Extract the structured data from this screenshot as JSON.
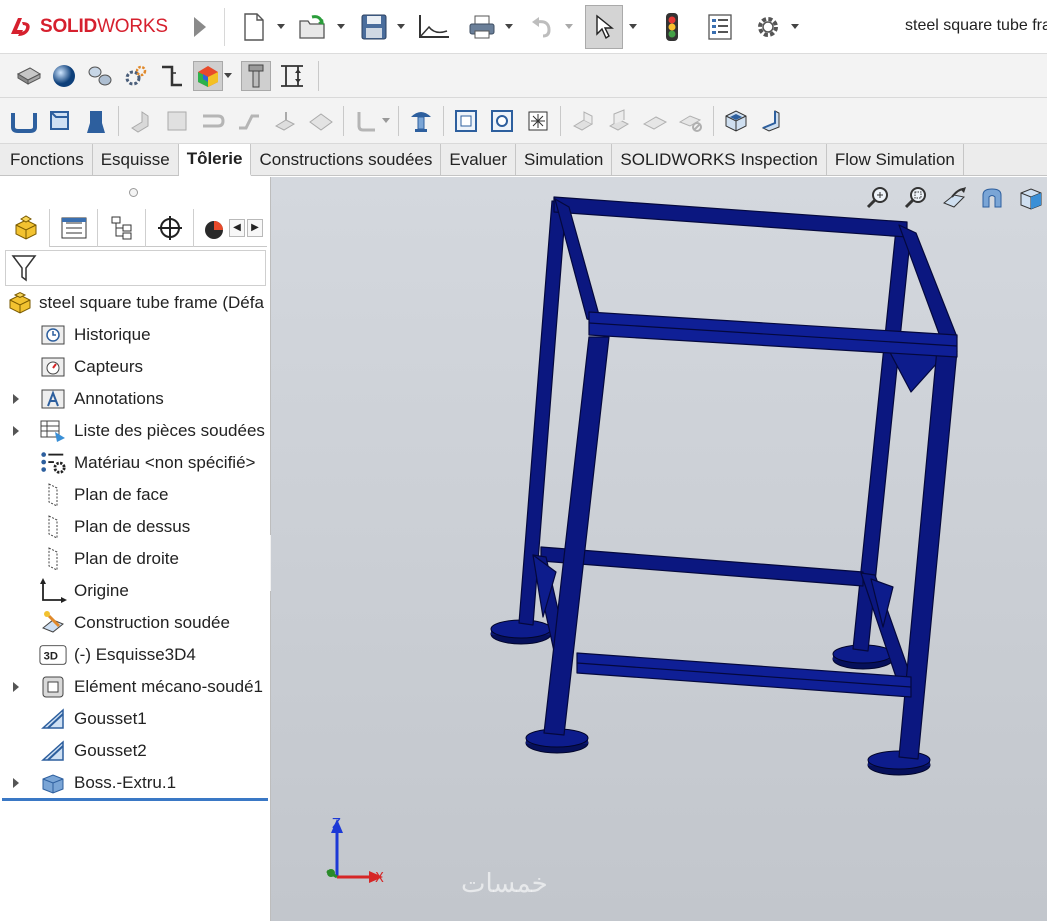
{
  "app": {
    "brand_prefix": "SOLID",
    "brand_suffix": "WORKS",
    "document_title": "steel square tube frame"
  },
  "tabs": [
    {
      "label": "Fonctions",
      "active": false
    },
    {
      "label": "Esquisse",
      "active": false
    },
    {
      "label": "Tôlerie",
      "active": true
    },
    {
      "label": "Constructions soudées",
      "active": false
    },
    {
      "label": "Evaluer",
      "active": false
    },
    {
      "label": "Simulation",
      "active": false
    },
    {
      "label": "SOLIDWORKS Inspection",
      "active": false
    },
    {
      "label": "Flow Simulation",
      "active": false
    }
  ],
  "tree": {
    "root": "steel square tube frame (Défa",
    "items": [
      {
        "label": "Historique",
        "icon": "history-icon",
        "expandable": false
      },
      {
        "label": "Capteurs",
        "icon": "sensor-icon",
        "expandable": false
      },
      {
        "label": "Annotations",
        "icon": "annotations-icon",
        "expandable": true
      },
      {
        "label": "Liste des pièces soudées",
        "icon": "cut-list-icon",
        "expandable": true
      },
      {
        "label": "Matériau <non spécifié>",
        "icon": "material-icon",
        "expandable": false
      },
      {
        "label": "Plan de face",
        "icon": "plane-icon",
        "expandable": false
      },
      {
        "label": "Plan de dessus",
        "icon": "plane-icon",
        "expandable": false
      },
      {
        "label": "Plan de droite",
        "icon": "plane-icon",
        "expandable": false
      },
      {
        "label": "Origine",
        "icon": "origin-icon",
        "expandable": false
      },
      {
        "label": "Construction soudée",
        "icon": "weldment-icon",
        "expandable": false
      },
      {
        "label": "(-) Esquisse3D4",
        "icon": "sketch3d-icon",
        "expandable": false
      },
      {
        "label": "Elément mécano-soudé1",
        "icon": "structural-member-icon",
        "expandable": true
      },
      {
        "label": "Gousset1",
        "icon": "gusset-icon",
        "expandable": false
      },
      {
        "label": "Gousset2",
        "icon": "gusset-icon",
        "expandable": false
      },
      {
        "label": "Boss.-Extru.1",
        "icon": "extrude-icon",
        "expandable": true
      }
    ]
  },
  "triad": {
    "z": "Z",
    "x": "X"
  },
  "watermark": "خمسات",
  "colors": {
    "frame": "#0b1780",
    "frame_edge": "#04083d",
    "brand_red": "#d6202e"
  }
}
